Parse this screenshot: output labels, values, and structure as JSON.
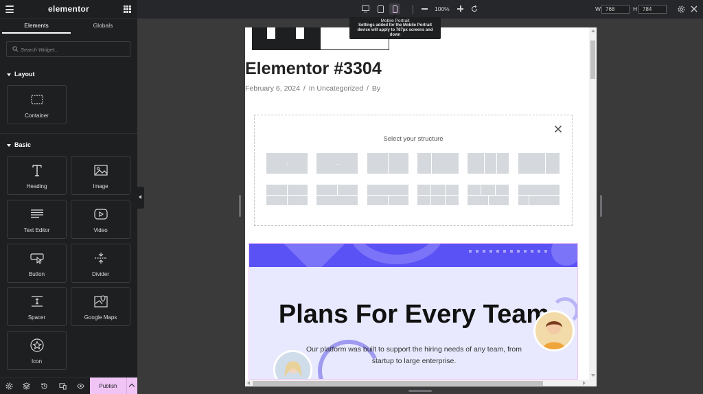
{
  "app": {
    "brand": "elementor"
  },
  "panel": {
    "tabs": [
      {
        "label": "Elements"
      },
      {
        "label": "Globals"
      }
    ],
    "search_placeholder": "Search Widget...",
    "sections": [
      {
        "title": "Layout",
        "widgets": [
          {
            "label": "Container",
            "icon": "container-icon"
          }
        ]
      },
      {
        "title": "Basic",
        "widgets": [
          {
            "label": "Heading",
            "icon": "heading-icon"
          },
          {
            "label": "Image",
            "icon": "image-icon"
          },
          {
            "label": "Text Editor",
            "icon": "text-editor-icon"
          },
          {
            "label": "Video",
            "icon": "video-icon"
          },
          {
            "label": "Button",
            "icon": "button-icon"
          },
          {
            "label": "Divider",
            "icon": "divider-icon"
          },
          {
            "label": "Spacer",
            "icon": "spacer-icon"
          },
          {
            "label": "Google Maps",
            "icon": "map-icon"
          },
          {
            "label": "Icon",
            "icon": "star-icon"
          }
        ]
      }
    ],
    "footer": {
      "publish_label": "Publish"
    }
  },
  "toolbar": {
    "devices": [
      "desktop",
      "tablet",
      "mobile"
    ],
    "active_device": "mobile",
    "zoom": "100%",
    "width_label": "W",
    "width_value": "768",
    "height_label": "H",
    "height_value": "784",
    "tooltip": {
      "title": "Mobile Portrait",
      "text": "Settings added for the Mobile Portrait device will apply to 767px screens and down"
    }
  },
  "preview": {
    "post_title": "Elementor #3304",
    "meta": {
      "date": "February 6, 2024",
      "sep": "/",
      "category": "In Uncategorized",
      "by": "By"
    },
    "structure": {
      "title": "Select your structure",
      "presets_row1": [
        "↓",
        "→",
        "2col",
        "1-2",
        "3col",
        "2-1"
      ],
      "presets_row2": [
        "r1",
        "r2",
        "r3",
        "r4",
        "r5",
        "r6"
      ]
    },
    "hero": {
      "title": "Plans For Every Team",
      "subtitle": "Our platform was built to support the hiring needs of any team, from startup to large enterprise.",
      "accent": "#5b52f5",
      "background": "#e8e9fe"
    }
  },
  "colors": {
    "panel_bg": "#1e1f21",
    "publish_bg": "#f0c4f5",
    "canvas_bg": "#3a3a3a"
  }
}
